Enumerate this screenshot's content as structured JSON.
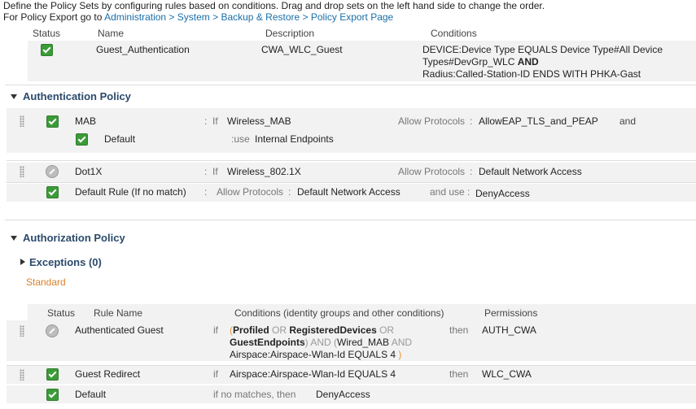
{
  "intro": {
    "line1": "Define the Policy Sets by configuring rules based on conditions. Drag and drop sets on the left hand side to change the order.",
    "line2_prefix": "For Policy Export go to ",
    "line2_link": "Administration > System > Backup & Restore > Policy Export Page"
  },
  "policy_set": {
    "headers": {
      "status": "Status",
      "name": "Name",
      "description": "Description",
      "conditions": "Conditions"
    },
    "row": {
      "name": "Guest_Authentication",
      "description": "CWA_WLC_Guest",
      "cond_line1": "DEVICE:Device Type EQUALS Device Type#All Device",
      "cond_line2a": "Types#DevGrp_WLC",
      "cond_line2b": "AND",
      "cond_line3": "Radius:Called-Station-ID ENDS WITH PHKA-Gast"
    }
  },
  "authentication": {
    "title": "Authentication Policy",
    "rule1": {
      "name": "MAB",
      "colon": ":",
      "if": "If",
      "condition": "Wireless_MAB",
      "allow_label": "Allow Protocols",
      "allow_colon": ":",
      "protocol": "AllowEAP_TLS_and_PEAP",
      "and": "and",
      "sub_name": "Default",
      "use_label": ":use",
      "identity": "Internal Endpoints"
    },
    "rule2": {
      "name": "Dot1X",
      "colon": ":",
      "if": "If",
      "condition": "Wireless_802.1X",
      "allow_label": "Allow Protocols",
      "allow_colon": ":",
      "protocol": "Default Network Access"
    },
    "default_rule": {
      "name": "Default Rule (If no match)",
      "colon": ":",
      "allow_label": "Allow Protocols",
      "allow_colon": ":",
      "protocol": "Default Network Access",
      "use_label": "and use :",
      "identity": "DenyAccess"
    }
  },
  "authorization": {
    "title": "Authorization Policy",
    "exceptions": "Exceptions (0)",
    "standard": "Standard",
    "headers": {
      "status": "Status",
      "rule_name": "Rule Name",
      "conditions": "Conditions (identity groups and other conditions)",
      "permissions": "Permissions"
    },
    "rules": [
      {
        "name": "Authenticated Guest",
        "if": "if",
        "then": "then",
        "permission": "AUTH_CWA",
        "c_open": "(",
        "c_profiled": "Profiled",
        "c_or1": "OR",
        "c_registered": "RegisteredDevices",
        "c_or2": "OR",
        "c_guest": "GuestEndpoints",
        "c_close_and": ") AND (",
        "c_wired": "Wired_MAB",
        "c_and": "AND",
        "c_airspace": "Airspace:Airspace-Wlan-Id EQUALS 4",
        "c_end": ")"
      },
      {
        "name": "Guest Redirect",
        "if": "if",
        "then": "then",
        "permission": "WLC_CWA",
        "condition": "Airspace:Airspace-Wlan-Id EQUALS 4"
      },
      {
        "name": "Default",
        "nomatch": "if no matches, then",
        "permission": "DenyAccess"
      }
    ]
  },
  "colors": {
    "check_green": "#3c9b39",
    "link_blue": "#1a6fa8",
    "standard_orange": "#d9822b",
    "section_title": "#2b4a6b"
  }
}
